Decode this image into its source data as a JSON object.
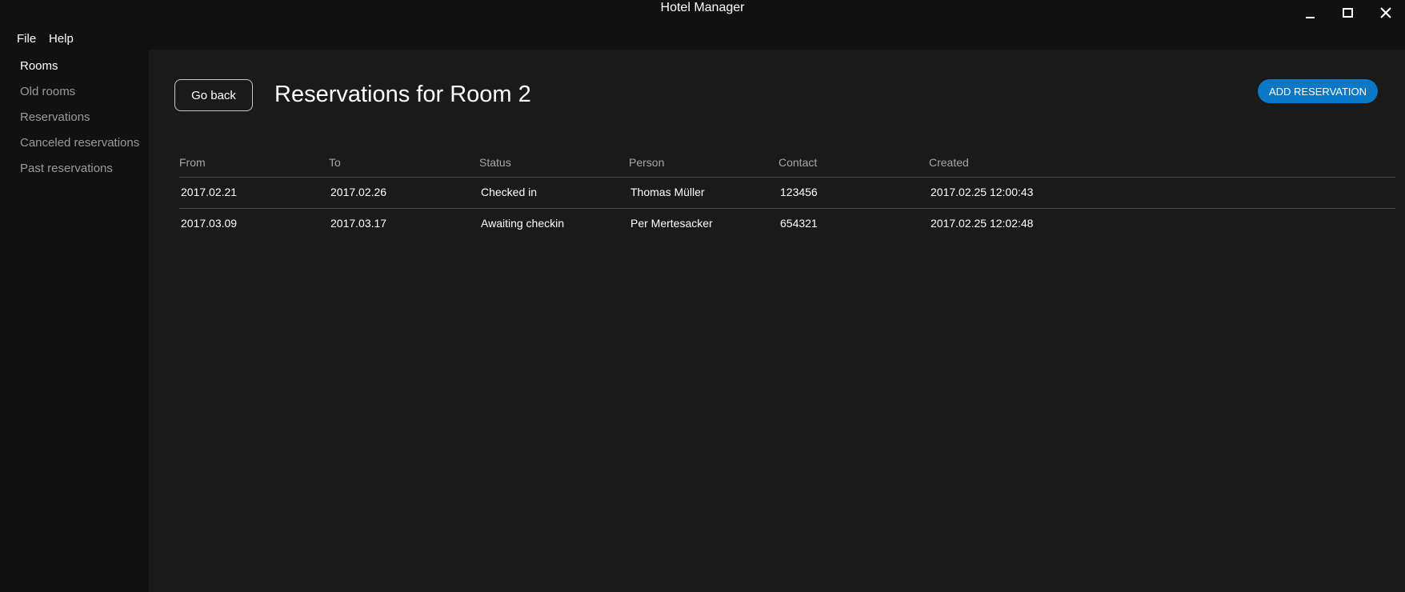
{
  "window": {
    "title": "Hotel Manager",
    "controls": {
      "minimize_icon": "minimize-icon",
      "maximize_icon": "maximize-icon",
      "close_icon": "close-icon"
    }
  },
  "menu": {
    "file": "File",
    "help": "Help"
  },
  "sidebar": {
    "items": [
      {
        "label": "Rooms",
        "active": true
      },
      {
        "label": "Old rooms",
        "active": false
      },
      {
        "label": "Reservations",
        "active": false
      },
      {
        "label": "Canceled reservations",
        "active": false
      },
      {
        "label": "Past reservations",
        "active": false
      }
    ]
  },
  "header": {
    "back_label": "Go back",
    "title": "Reservations for Room 2",
    "add_label": "ADD RESERVATION"
  },
  "table": {
    "columns": [
      "From",
      "To",
      "Status",
      "Person",
      "Contact",
      "Created"
    ],
    "rows": [
      [
        "2017.02.21",
        "2017.02.26",
        "Checked in",
        "Thomas Müller",
        "123456",
        "2017.02.25 12:00:43"
      ],
      [
        "2017.03.09",
        "2017.03.17",
        "Awaiting checkin",
        "Per Mertesacker",
        "654321",
        "2017.02.25 12:02:48"
      ]
    ]
  },
  "colors": {
    "background": "#111111",
    "content_background": "#1a1a1a",
    "accent": "#0a78c7",
    "muted_text": "#9a9a9a"
  }
}
